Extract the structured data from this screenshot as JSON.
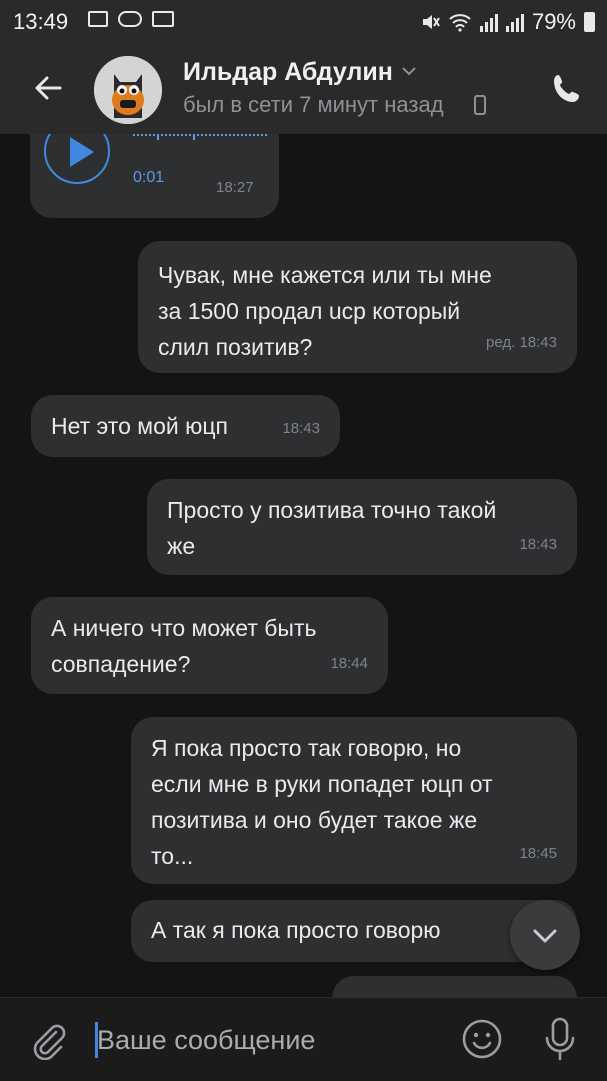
{
  "status_bar": {
    "time": "13:49",
    "battery": "79%"
  },
  "header": {
    "contact_name": "Ильдар Абдулин",
    "contact_status": "был в сети 7 минут назад"
  },
  "messages": [
    {
      "type": "voice",
      "direction": "in",
      "duration": "0:01",
      "time": "18:27"
    },
    {
      "direction": "out",
      "text": "Чувак, мне кажется или ты мне\nза 1500 продал ucp который\nслил позитив?",
      "time": "ред. 18:43"
    },
    {
      "direction": "in",
      "text": "Нет это мой юцп",
      "time": "18:43"
    },
    {
      "direction": "out",
      "text": "Просто у позитива точно такой\nже",
      "time": "18:43"
    },
    {
      "direction": "in",
      "text": "А ничего что может быть\nсовпадение?",
      "time": "18:44"
    },
    {
      "direction": "out",
      "text": "Я пока просто так говорю, но\nесли мне в руки попадет юцп от\nпозитива и оно будет такое же\nто...",
      "time": "18:45"
    },
    {
      "direction": "out",
      "text": "А так я пока просто говорю"
    }
  ],
  "composer": {
    "placeholder": "Ваше сообщение"
  },
  "colors": {
    "accent": "#3f8ae0",
    "bubble": "#2e2f31",
    "background": "#141414",
    "header": "#2a2a2b"
  }
}
